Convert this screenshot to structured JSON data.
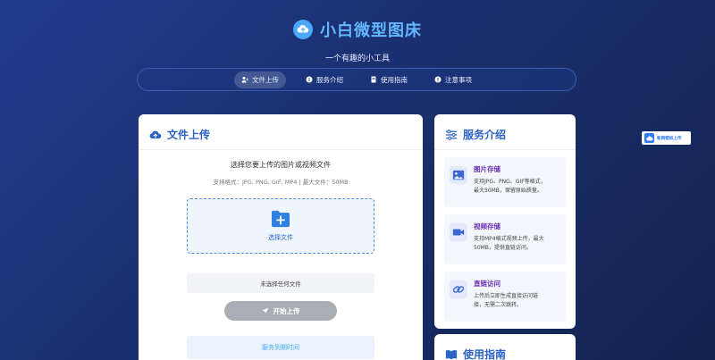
{
  "header": {
    "title": "小白微型图床",
    "subtitle": "一个有趣的小工具"
  },
  "nav": {
    "items": [
      {
        "label": "文件上传",
        "icon": "user-upload-icon",
        "active": true
      },
      {
        "label": "服务介绍",
        "icon": "info-icon",
        "active": false
      },
      {
        "label": "使用指南",
        "icon": "book-icon",
        "active": false
      },
      {
        "label": "注意事项",
        "icon": "warning-icon",
        "active": false
      }
    ]
  },
  "upload": {
    "title": "文件上传",
    "choose_text": "选择您要上传的图片或视频文件",
    "format_text": "支持格式：JPG, PNG, GIF, MP4 | 最大文件：50MB",
    "drop_label": "选择文件",
    "file_status": "未选择任何文件",
    "button_label": "开始上传",
    "expiry_label": "服务到期时间"
  },
  "service": {
    "title": "服务介绍",
    "items": [
      {
        "title": "图片存储",
        "desc_line1": "支持JPG、PNG、GIF等格式，",
        "desc_line2": "最大50MB，保留原始质量。",
        "icon": "image-icon"
      },
      {
        "title": "视频存储",
        "desc_line1": "支持MP4格式视频上传，最大",
        "desc_line2": "50MB，提供直链访问。",
        "icon": "video-icon"
      },
      {
        "title": "直链访问",
        "desc_line1": "上传后立即生成直接访问链",
        "desc_line2": "接，无需二次跳转。",
        "icon": "link-icon"
      }
    ]
  },
  "guide": {
    "title": "使用指南"
  },
  "floating_badge": {
    "label": "新网壁纸上传"
  },
  "colors": {
    "accent": "#2b63c7",
    "brand": "#63b7ff",
    "service_title": "#6a2fb4",
    "button_disabled": "#a9adb4"
  }
}
